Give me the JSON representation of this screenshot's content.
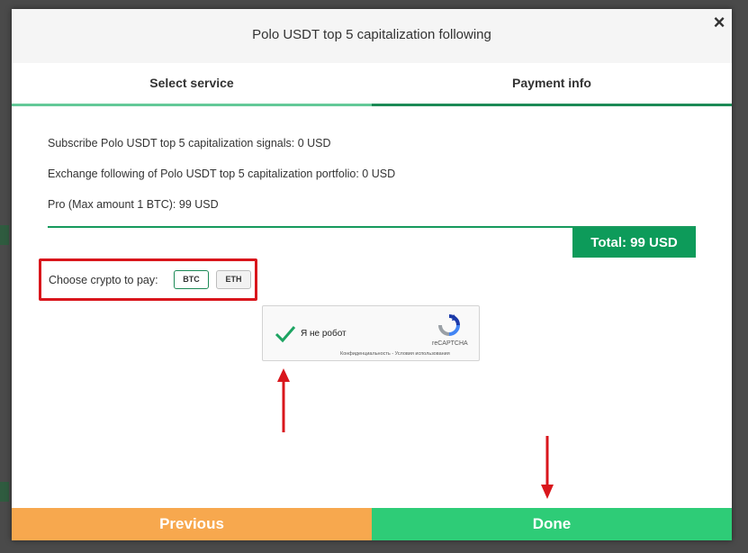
{
  "modal": {
    "title": "Polo USDT top 5 capitalization following",
    "close_icon": "×"
  },
  "tabs": [
    {
      "label": "Select service"
    },
    {
      "label": "Payment info"
    }
  ],
  "summary": {
    "lines": [
      "Subscribe Polo USDT top 5 capitalization signals: 0 USD",
      "Exchange following of Polo USDT top 5 capitalization portfolio: 0 USD",
      "Pro (Max amount 1 BTC): 99 USD"
    ],
    "total": "Total: 99 USD"
  },
  "crypto": {
    "label": "Choose crypto to pay:",
    "options": [
      "BTC",
      "ETH"
    ],
    "selected": "BTC"
  },
  "captcha": {
    "label": "Я не робот",
    "brand": "reCAPTCHA",
    "links": "Конфиденциальность - Условия использования"
  },
  "footer": {
    "previous": "Previous",
    "done": "Done"
  },
  "colors": {
    "accent_green": "#0d9b5a",
    "done_green": "#2ecc77",
    "previous_orange": "#f7a84e",
    "annotation_red": "#d9161c"
  }
}
